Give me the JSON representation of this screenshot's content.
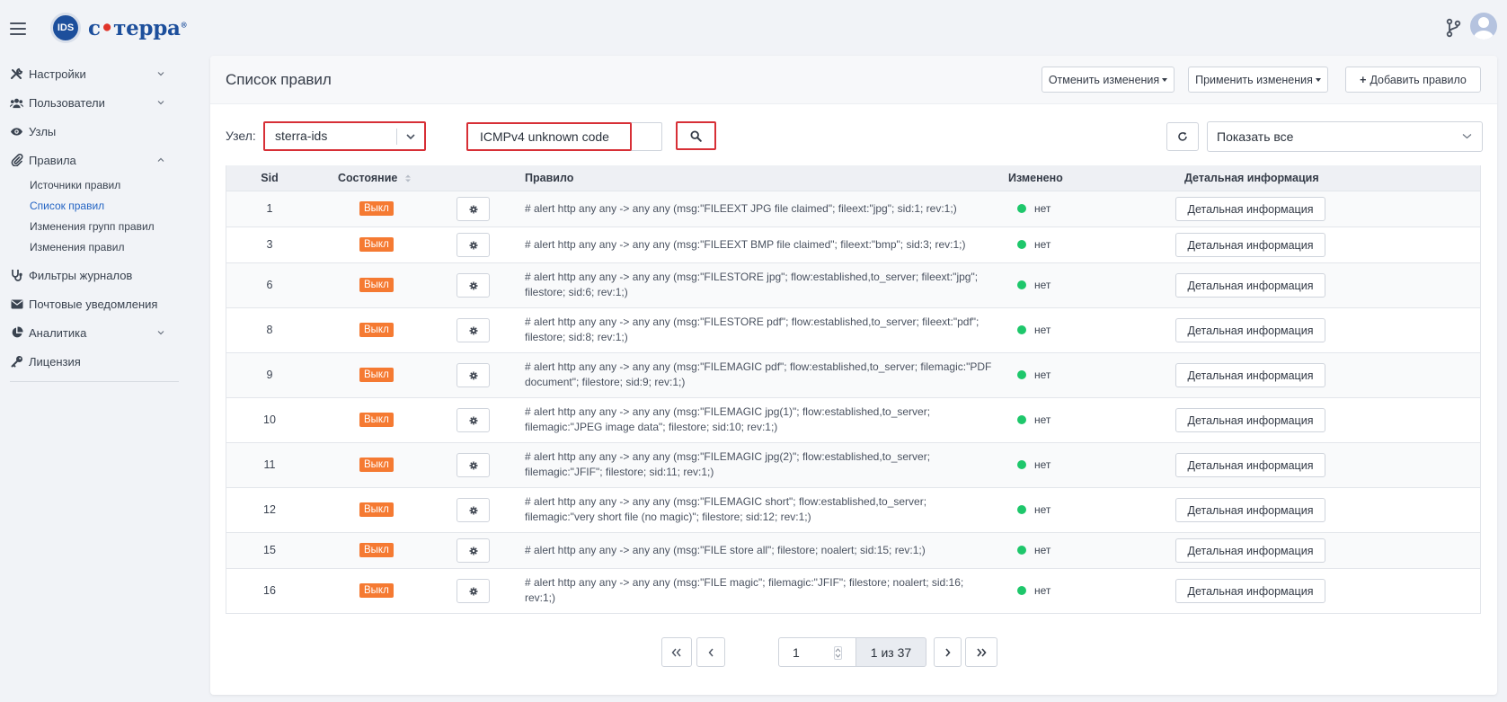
{
  "brand": {
    "badge": "IDS",
    "name_left": "с",
    "name_right": "терра",
    "reg": "®"
  },
  "sidebar": {
    "items": [
      {
        "label": "Настройки",
        "icon": "tools-icon",
        "expandable": true,
        "expanded": false
      },
      {
        "label": "Пользователи",
        "icon": "users-icon",
        "expandable": true,
        "expanded": false
      },
      {
        "label": "Узлы",
        "icon": "eye-icon",
        "expandable": false
      },
      {
        "label": "Правила",
        "icon": "paperclip-icon",
        "expandable": true,
        "expanded": true
      },
      {
        "label": "Фильтры журналов",
        "icon": "stethoscope-icon",
        "expandable": false
      },
      {
        "label": "Почтовые уведомления",
        "icon": "envelope-icon",
        "expandable": false
      },
      {
        "label": "Аналитика",
        "icon": "pie-chart-icon",
        "expandable": true,
        "expanded": false
      },
      {
        "label": "Лицензия",
        "icon": "key-icon",
        "expandable": false
      }
    ],
    "rules_subitems": [
      {
        "label": "Источники правил",
        "active": false
      },
      {
        "label": "Список правил",
        "active": true
      },
      {
        "label": "Изменения групп правил",
        "active": false
      },
      {
        "label": "Изменения правил",
        "active": false
      }
    ]
  },
  "header": {
    "title": "Список правил",
    "cancel_label": "Отменить изменения",
    "apply_label": "Применить изменения",
    "add_label": "Добавить правило",
    "add_prefix": "+"
  },
  "filters": {
    "node_label": "Узел:",
    "node_value": "sterra-ids",
    "search_value": "ICMPv4 unknown code",
    "show_value": "Показать все"
  },
  "table": {
    "columns": [
      "Sid",
      "Состояние",
      "Правило",
      "Изменено",
      "Детальная информация"
    ],
    "rows": [
      {
        "sid": "1",
        "state": "Выкл",
        "rule": "# alert http any any -> any any (msg:\"FILEEXT JPG file claimed\"; fileext:\"jpg\"; sid:1; rev:1;)",
        "changed": "нет",
        "detail": "Детальная информация"
      },
      {
        "sid": "3",
        "state": "Выкл",
        "rule": "# alert http any any -> any any (msg:\"FILEEXT BMP file claimed\"; fileext:\"bmp\"; sid:3; rev:1;)",
        "changed": "нет",
        "detail": "Детальная информация"
      },
      {
        "sid": "6",
        "state": "Выкл",
        "rule": "# alert http any any -> any any (msg:\"FILESTORE jpg\"; flow:established,to_server; fileext:\"jpg\"; filestore; sid:6; rev:1;)",
        "changed": "нет",
        "detail": "Детальная информация"
      },
      {
        "sid": "8",
        "state": "Выкл",
        "rule": "# alert http any any -> any any (msg:\"FILESTORE pdf\"; flow:established,to_server; fileext:\"pdf\"; filestore; sid:8; rev:1;)",
        "changed": "нет",
        "detail": "Детальная информация"
      },
      {
        "sid": "9",
        "state": "Выкл",
        "rule": "# alert http any any -> any any (msg:\"FILEMAGIC pdf\"; flow:established,to_server; filemagic:\"PDF document\"; filestore; sid:9; rev:1;)",
        "changed": "нет",
        "detail": "Детальная информация"
      },
      {
        "sid": "10",
        "state": "Выкл",
        "rule": "# alert http any any -> any any (msg:\"FILEMAGIC jpg(1)\"; flow:established,to_server; filemagic:\"JPEG image data\"; filestore; sid:10; rev:1;)",
        "changed": "нет",
        "detail": "Детальная информация"
      },
      {
        "sid": "11",
        "state": "Выкл",
        "rule": "# alert http any any -> any any (msg:\"FILEMAGIC jpg(2)\"; flow:established,to_server; filemagic:\"JFIF\"; filestore; sid:11; rev:1;)",
        "changed": "нет",
        "detail": "Детальная информация"
      },
      {
        "sid": "12",
        "state": "Выкл",
        "rule": "# alert http any any -> any any (msg:\"FILEMAGIC short\"; flow:established,to_server; filemagic:\"very short file (no magic)\"; filestore; sid:12; rev:1;)",
        "changed": "нет",
        "detail": "Детальная информация"
      },
      {
        "sid": "15",
        "state": "Выкл",
        "rule": "# alert http any any -> any any (msg:\"FILE store all\"; filestore; noalert; sid:15; rev:1;)",
        "changed": "нет",
        "detail": "Детальная информация"
      },
      {
        "sid": "16",
        "state": "Выкл",
        "rule": "# alert http any any -> any any (msg:\"FILE magic\"; filemagic:\"JFIF\"; filestore; noalert; sid:16; rev:1;)",
        "changed": "нет",
        "detail": "Детальная информация"
      }
    ]
  },
  "pagination": {
    "current": "1",
    "summary": "1 из 37"
  },
  "colors": {
    "accent": "#2565c4",
    "badge_off": "#f57a32",
    "ok": "#1ec76b",
    "highlight": "#d72f36"
  }
}
